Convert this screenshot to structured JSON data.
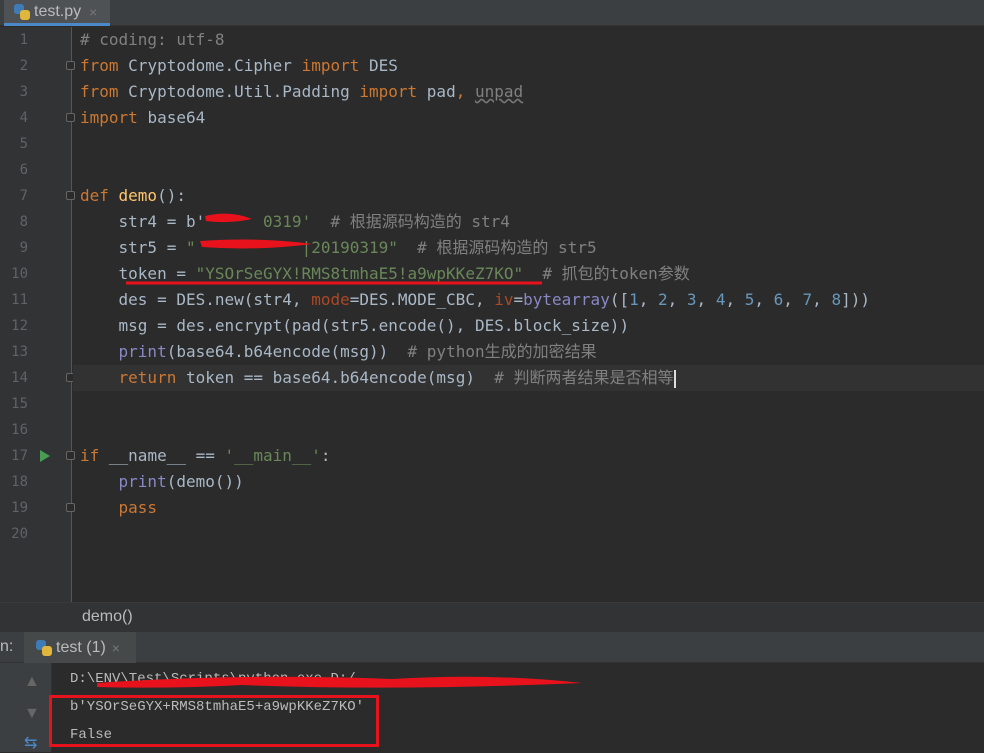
{
  "tab": {
    "filename": "test.py",
    "close": "×"
  },
  "line_numbers": [
    "1",
    "2",
    "3",
    "4",
    "5",
    "6",
    "7",
    "8",
    "9",
    "10",
    "11",
    "12",
    "13",
    "14",
    "15",
    "16",
    "17",
    "18",
    "19",
    "20"
  ],
  "code": [
    [
      [
        "# coding: utf-8",
        "cm"
      ]
    ],
    [
      [
        "from ",
        "kw"
      ],
      [
        "Cryptodome.Cipher ",
        ""
      ],
      [
        "import ",
        "kw"
      ],
      [
        "DES",
        ""
      ]
    ],
    [
      [
        "from ",
        "kw"
      ],
      [
        "Cryptodome.Util.Padding ",
        ""
      ],
      [
        "import ",
        "kw"
      ],
      [
        "pad",
        ""
      ],
      [
        ", ",
        "kw"
      ],
      [
        "unpad",
        "ul cm"
      ]
    ],
    [
      [
        "import ",
        "kw"
      ],
      [
        "base64",
        ""
      ]
    ],
    [],
    [],
    [
      [
        "def ",
        "kw"
      ],
      [
        "demo",
        "fn"
      ],
      [
        "():",
        ""
      ]
    ],
    [
      [
        "    str4 = ",
        ""
      ],
      [
        "b'",
        ""
      ],
      [
        "      0319'",
        "str"
      ],
      [
        "  # 根据源码构造的 str4",
        "cm"
      ]
    ],
    [
      [
        "    str5 = ",
        ""
      ],
      [
        "\"           |20190319\"",
        "str"
      ],
      [
        "  # 根据源码构造的 str5",
        "cm"
      ]
    ],
    [
      [
        "    token = ",
        ""
      ],
      [
        "\"YSOrSeGYX!RMS8tmhaE5!a9wpKKeZ7KO\"",
        "str"
      ],
      [
        "  # 抓包的token参数",
        "cm"
      ]
    ],
    [
      [
        "    des = DES.new(str4, ",
        ""
      ],
      [
        "mode",
        "kwa"
      ],
      [
        "=DES.MODE_CBC, ",
        ""
      ],
      [
        "iv",
        "kwa"
      ],
      [
        "=",
        ""
      ],
      [
        "bytearray",
        "bi"
      ],
      [
        "([",
        ""
      ],
      [
        "1",
        "num"
      ],
      [
        ", ",
        ""
      ],
      [
        "2",
        "num"
      ],
      [
        ", ",
        ""
      ],
      [
        "3",
        "num"
      ],
      [
        ", ",
        ""
      ],
      [
        "4",
        "num"
      ],
      [
        ", ",
        ""
      ],
      [
        "5",
        "num"
      ],
      [
        ", ",
        ""
      ],
      [
        "6",
        "num"
      ],
      [
        ", ",
        ""
      ],
      [
        "7",
        "num"
      ],
      [
        ", ",
        ""
      ],
      [
        "8",
        "num"
      ],
      [
        "]))",
        ""
      ]
    ],
    [
      [
        "    msg = des.encrypt(pad(str5.encode(), DES.block_size))",
        ""
      ]
    ],
    [
      [
        "    ",
        ""
      ],
      [
        "print",
        "bi"
      ],
      [
        "(base64.b64encode(msg))  ",
        ""
      ],
      [
        "# python生成的加密结果",
        "cm"
      ]
    ],
    [
      [
        "    ",
        ""
      ],
      [
        "return ",
        "kw"
      ],
      [
        "token == base64.b64encode(msg)  ",
        ""
      ],
      [
        "# 判断两者结果是否相等",
        "cm"
      ]
    ],
    [],
    [],
    [
      [
        "if ",
        "kw"
      ],
      [
        "__name__ == ",
        ""
      ],
      [
        "'__main__'",
        "str"
      ],
      [
        ":",
        ""
      ]
    ],
    [
      [
        "    ",
        ""
      ],
      [
        "print",
        "bi"
      ],
      [
        "(demo())",
        ""
      ]
    ],
    [
      [
        "    ",
        ""
      ],
      [
        "pass",
        "kw"
      ]
    ],
    []
  ],
  "breadcrumb": "demo()",
  "run_panel": {
    "label": "n:",
    "tab": "test (1)",
    "close": "×"
  },
  "console": [
    "D:\\ENV\\Test\\Scripts\\python.exe D:/...",
    "b'YSOrSeGYX+RMS8tmhaE5+a9wpKKeZ7KO'",
    "False"
  ]
}
